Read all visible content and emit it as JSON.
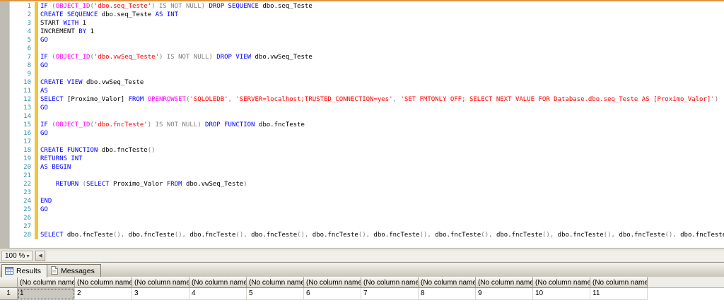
{
  "theme": {
    "keyword": "#0000ff",
    "builtin_function": "#ff00ff",
    "string": "#ff0000",
    "operator": "#808080",
    "identifier": "#000000",
    "line_number": "#2b91af",
    "change_bar_yellow": "#f0c53c",
    "pane_top_border_orange": "#e1943e",
    "selected_cell_bg": "#cbc8c1"
  },
  "editor": {
    "lines": [
      {
        "n": "1",
        "segs": [
          [
            "k",
            "IF"
          ],
          [
            "g",
            " ("
          ],
          [
            "f",
            "OBJECT_ID"
          ],
          [
            "g",
            "("
          ],
          [
            "s",
            "'dbo.seq_Teste'"
          ],
          [
            "g",
            ") IS NOT NULL) "
          ],
          [
            "k",
            "DROP SEQUENCE"
          ],
          [
            "d",
            " dbo.seq_Teste"
          ]
        ]
      },
      {
        "n": "2",
        "segs": [
          [
            "k",
            "CREATE SEQUENCE"
          ],
          [
            "d",
            " dbo.seq_Teste "
          ],
          [
            "k",
            "AS INT"
          ]
        ]
      },
      {
        "n": "3",
        "segs": [
          [
            "d",
            "START "
          ],
          [
            "k",
            "WITH"
          ],
          [
            "d",
            " 1"
          ]
        ]
      },
      {
        "n": "4",
        "segs": [
          [
            "d",
            "INCREMENT "
          ],
          [
            "k",
            "BY"
          ],
          [
            "d",
            " 1"
          ]
        ]
      },
      {
        "n": "5",
        "segs": [
          [
            "k",
            "GO"
          ]
        ]
      },
      {
        "n": "6",
        "segs": []
      },
      {
        "n": "7",
        "segs": [
          [
            "k",
            "IF"
          ],
          [
            "g",
            " ("
          ],
          [
            "f",
            "OBJECT_ID"
          ],
          [
            "g",
            "("
          ],
          [
            "s",
            "'dbo.vwSeq_Teste'"
          ],
          [
            "g",
            ") IS NOT NULL) "
          ],
          [
            "k",
            "DROP VIEW"
          ],
          [
            "d",
            " dbo.vwSeq_Teste"
          ]
        ]
      },
      {
        "n": "8",
        "segs": [
          [
            "k",
            "GO"
          ]
        ]
      },
      {
        "n": "9",
        "segs": []
      },
      {
        "n": "10",
        "segs": [
          [
            "k",
            "CREATE VIEW"
          ],
          [
            "d",
            " dbo.vwSeq_Teste"
          ]
        ]
      },
      {
        "n": "11",
        "segs": [
          [
            "k",
            "AS"
          ]
        ]
      },
      {
        "n": "12",
        "segs": [
          [
            "k",
            "SELECT"
          ],
          [
            "d",
            " [Proximo_Valor] "
          ],
          [
            "k",
            "FROM"
          ],
          [
            "d",
            " "
          ],
          [
            "f",
            "OPENROWSET"
          ],
          [
            "g",
            "("
          ],
          [
            "s",
            "'SQLOLEDB'"
          ],
          [
            "g",
            ", "
          ],
          [
            "s",
            "'SERVER=localhost;TRUSTED_CONNECTION=yes'"
          ],
          [
            "g",
            ", "
          ],
          [
            "s",
            "'SET FMTONLY OFF; SELECT NEXT VALUE FOR Database.dbo.seq_Teste AS [Proximo_Valor]'"
          ],
          [
            "g",
            ")"
          ]
        ]
      },
      {
        "n": "13",
        "segs": [
          [
            "k",
            "GO"
          ]
        ]
      },
      {
        "n": "14",
        "segs": []
      },
      {
        "n": "15",
        "segs": [
          [
            "k",
            "IF"
          ],
          [
            "g",
            " ("
          ],
          [
            "f",
            "OBJECT_ID"
          ],
          [
            "g",
            "("
          ],
          [
            "s",
            "'dbo.fncTeste'"
          ],
          [
            "g",
            ") IS NOT NULL) "
          ],
          [
            "k",
            "DROP FUNCTION"
          ],
          [
            "d",
            " dbo.fncTeste"
          ]
        ]
      },
      {
        "n": "16",
        "segs": [
          [
            "k",
            "GO"
          ]
        ]
      },
      {
        "n": "17",
        "segs": []
      },
      {
        "n": "18",
        "segs": [
          [
            "k",
            "CREATE FUNCTION"
          ],
          [
            "d",
            " dbo.fncTeste"
          ],
          [
            "g",
            "()"
          ]
        ]
      },
      {
        "n": "19",
        "segs": [
          [
            "k",
            "RETURNS INT"
          ]
        ]
      },
      {
        "n": "20",
        "segs": [
          [
            "k",
            "AS BEGIN"
          ]
        ]
      },
      {
        "n": "21",
        "segs": []
      },
      {
        "n": "22",
        "segs": [
          [
            "d",
            "    "
          ],
          [
            "k",
            "RETURN"
          ],
          [
            "g",
            " ("
          ],
          [
            "k",
            "SELECT"
          ],
          [
            "d",
            " Proximo_Valor "
          ],
          [
            "k",
            "FROM"
          ],
          [
            "d",
            " dbo.vwSeq_Teste"
          ],
          [
            "g",
            ")"
          ]
        ]
      },
      {
        "n": "23",
        "segs": []
      },
      {
        "n": "24",
        "segs": [
          [
            "k",
            "END"
          ]
        ]
      },
      {
        "n": "25",
        "segs": [
          [
            "k",
            "GO"
          ]
        ]
      },
      {
        "n": "26",
        "segs": []
      },
      {
        "n": "27",
        "segs": []
      },
      {
        "n": "28",
        "segs": [
          [
            "k",
            "SELECT"
          ],
          [
            "d",
            " dbo.fncTeste"
          ],
          [
            "g",
            "(),"
          ],
          [
            "d",
            " dbo.fncTeste"
          ],
          [
            "g",
            "(),"
          ],
          [
            "d",
            " dbo.fncTeste"
          ],
          [
            "g",
            "(),"
          ],
          [
            "d",
            " dbo.fncTeste"
          ],
          [
            "g",
            "(),"
          ],
          [
            "d",
            " dbo.fncTeste"
          ],
          [
            "g",
            "(),"
          ],
          [
            "d",
            " dbo.fncTeste"
          ],
          [
            "g",
            "(),"
          ],
          [
            "d",
            " dbo.fncTeste"
          ],
          [
            "g",
            "(),"
          ],
          [
            "d",
            " dbo.fncTeste"
          ],
          [
            "g",
            "(),"
          ],
          [
            "d",
            " dbo.fncTeste"
          ],
          [
            "g",
            "(),"
          ],
          [
            "d",
            " dbo.fncTeste"
          ],
          [
            "g",
            "(),"
          ],
          [
            "d",
            " dbo.fncTeste"
          ],
          [
            "g",
            "()"
          ]
        ]
      }
    ]
  },
  "statusbar": {
    "zoom_level": "100 %"
  },
  "tabs": [
    {
      "label": "Results",
      "active": true
    },
    {
      "label": "Messages",
      "active": false
    }
  ],
  "results_grid": {
    "corner_label": "",
    "columns": [
      "(No column name)",
      "(No column name)",
      "(No column name)",
      "(No column name)",
      "(No column name)",
      "(No column name)",
      "(No column name)",
      "(No column name)",
      "(No column name)",
      "(No column name)",
      "(No column name)"
    ],
    "rows": [
      {
        "row_number": "1",
        "cells": [
          "1",
          "2",
          "3",
          "4",
          "5",
          "6",
          "7",
          "8",
          "9",
          "10",
          "11"
        ],
        "selected_cell_index": 0
      }
    ]
  }
}
